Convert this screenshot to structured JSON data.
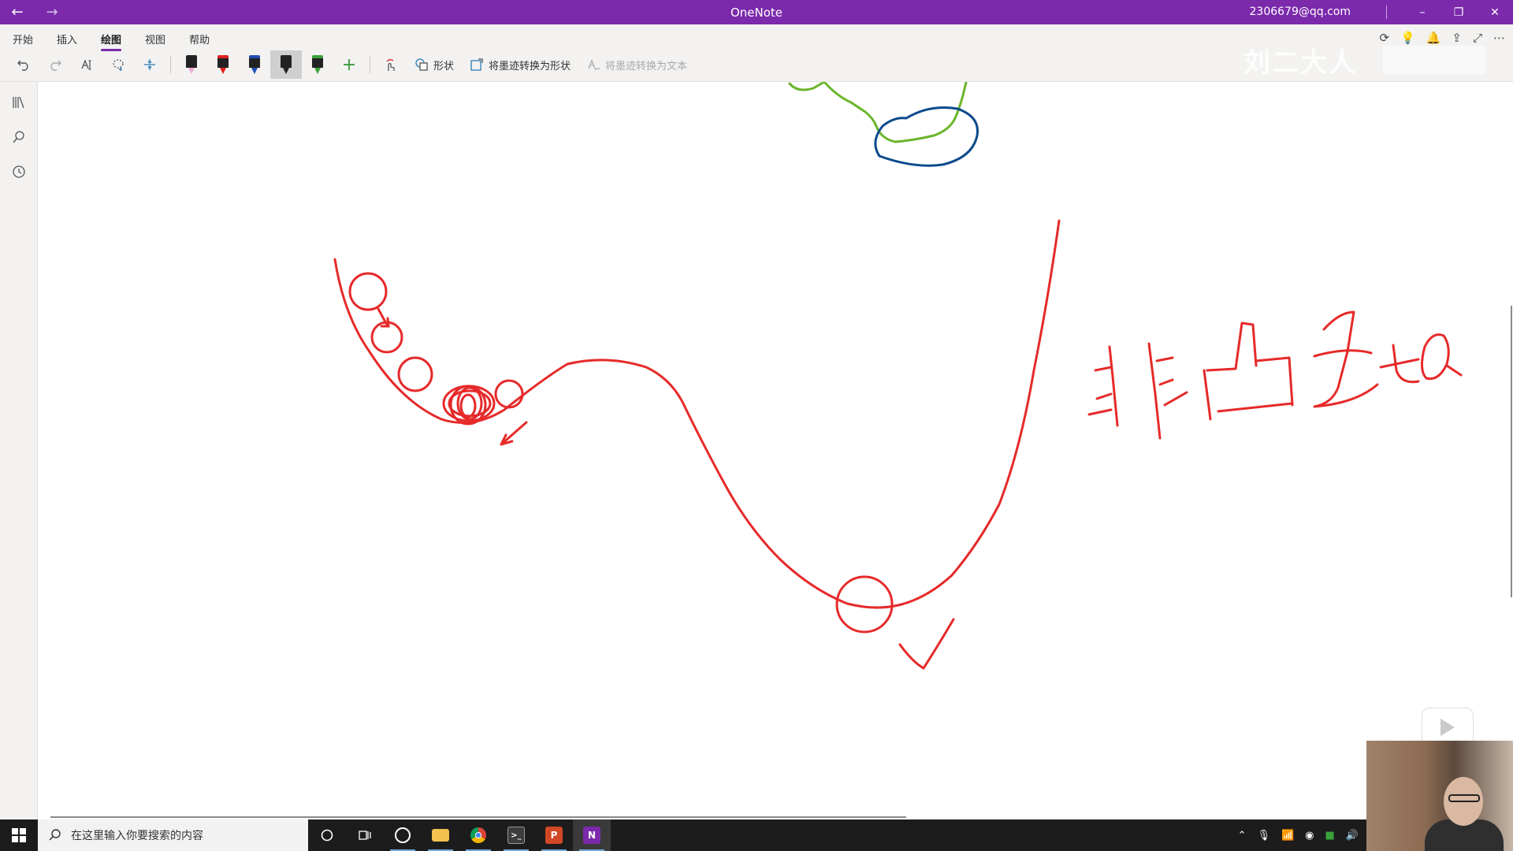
{
  "window": {
    "title": "OneNote",
    "account": "2306679@qq.com"
  },
  "ribbon": {
    "tabs": [
      {
        "label": "开始",
        "active": false
      },
      {
        "label": "插入",
        "active": false
      },
      {
        "label": "绘图",
        "active": true
      },
      {
        "label": "视图",
        "active": false
      },
      {
        "label": "帮助",
        "active": false
      }
    ],
    "shapes_label": "形状",
    "ink_to_shape_label": "将墨迹转换为形状",
    "ink_to_text_label": "将墨迹转换为文本",
    "pens": [
      {
        "name": "highlighter",
        "color": "#f3a6d6"
      },
      {
        "name": "red-pen",
        "color": "#e02020"
      },
      {
        "name": "blue-pen",
        "color": "#1f4fb5"
      },
      {
        "name": "black-pen",
        "color": "#222222",
        "selected": true
      },
      {
        "name": "green-pen",
        "color": "#3aa23a"
      }
    ]
  },
  "watermark": "刘二大人",
  "ink_colors": {
    "red": "#e62a2a",
    "green": "#6ab52a",
    "blue": "#0d4a8c"
  },
  "taskbar": {
    "search_placeholder": "在这里输入你要搜索的内容"
  },
  "colors": {
    "titlebar": "#7b2aab",
    "ribbon": "#f3f2f1",
    "taskbar": "#1c1c1c"
  }
}
